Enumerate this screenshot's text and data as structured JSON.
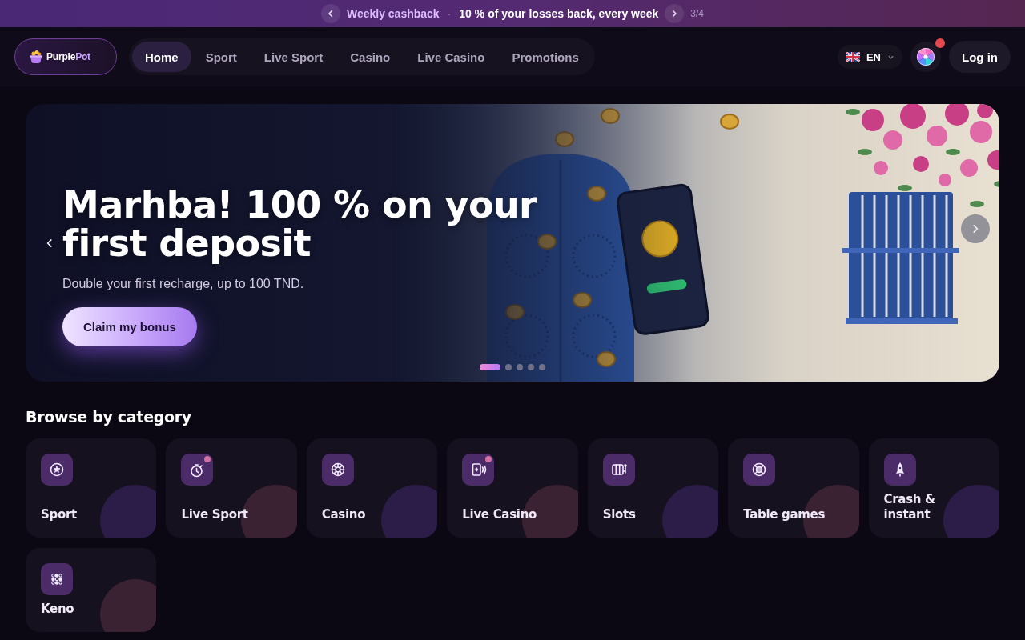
{
  "promo_bar": {
    "title": "Weekly cashback",
    "separator": "·",
    "text": "10 % of your losses back, every week",
    "counter": "3/4"
  },
  "header": {
    "logo": {
      "name_start": "Purple",
      "name_end": "Pot"
    },
    "nav": [
      {
        "label": "Home",
        "selected": true
      },
      {
        "label": "Sport",
        "selected": false
      },
      {
        "label": "Live Sport",
        "selected": false
      },
      {
        "label": "Casino",
        "selected": false
      },
      {
        "label": "Live Casino",
        "selected": false
      },
      {
        "label": "Promotions",
        "selected": false
      }
    ],
    "language": "EN",
    "notification_dot": true,
    "login": "Log in"
  },
  "hero": {
    "title": "Marhba! 100 % on your first deposit",
    "subtitle": "Double your first recharge, up to 100 TND.",
    "button": "Claim my bonus",
    "slides": [
      {
        "selected": true
      },
      {
        "selected": false
      },
      {
        "selected": false
      },
      {
        "selected": false
      },
      {
        "selected": false
      }
    ]
  },
  "categories": {
    "title": "Browse by category",
    "items": [
      {
        "label": "Sport",
        "live": false,
        "color": "#2c1c48"
      },
      {
        "label": "Live Sport",
        "live": true,
        "color": "#3a2233"
      },
      {
        "label": "Casino",
        "live": false,
        "color": "#2c1c48"
      },
      {
        "label": "Live Casino",
        "live": true,
        "color": "#3a2233"
      },
      {
        "label": "Slots",
        "live": false,
        "color": "#2c1c48"
      },
      {
        "label": "Table games",
        "live": false,
        "color": "#3a2233"
      },
      {
        "label": "Crash & instant",
        "live": false,
        "color": "#2c1c48"
      },
      {
        "label": "Keno",
        "live": false,
        "color": "#3a2233"
      }
    ]
  }
}
